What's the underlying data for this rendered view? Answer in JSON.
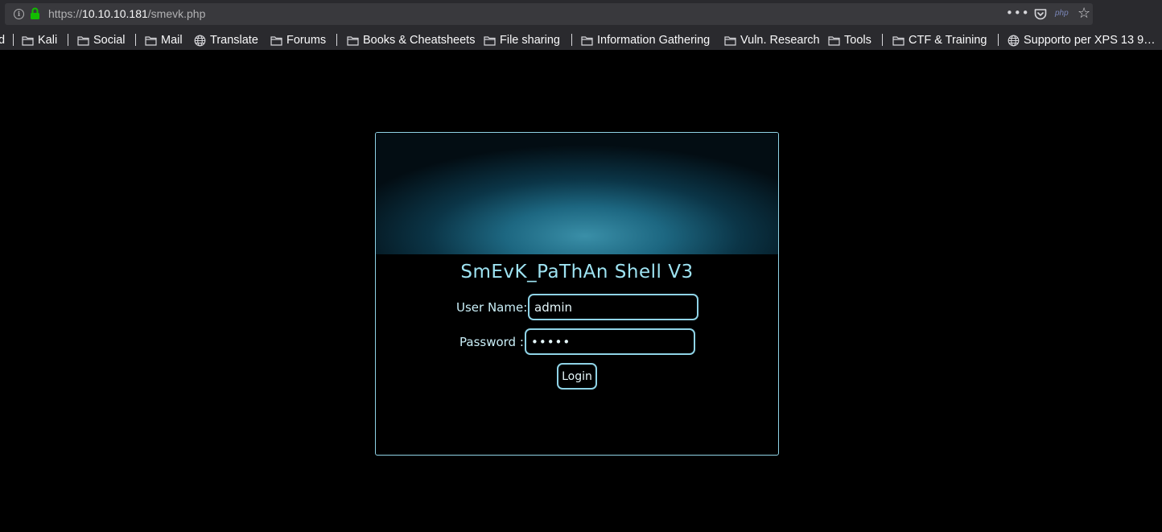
{
  "browser": {
    "url": {
      "scheme": "https://",
      "host": "10.10.10.181",
      "path": "/smevk.php"
    },
    "url_icons": [
      "info-icon",
      "lock-icon"
    ],
    "toolbar_icons": [
      "page-actions-icon",
      "pocket-icon",
      "php-icon",
      "star-icon"
    ],
    "php_label": "php",
    "page_actions_glyph": "•••",
    "star_glyph": "☆",
    "bookmarks": [
      {
        "label": "d",
        "icon": "none"
      },
      {
        "label": "Kali",
        "icon": "folder-icon"
      },
      {
        "label": "Social",
        "icon": "folder-icon"
      },
      {
        "label": "Mail",
        "icon": "folder-icon"
      },
      {
        "label": "Translate",
        "icon": "globe-icon"
      },
      {
        "label": "Forums",
        "icon": "folder-icon"
      },
      {
        "label": "Books & Cheatsheets",
        "icon": "folder-icon"
      },
      {
        "label": "File sharing",
        "icon": "folder-icon"
      },
      {
        "label": "Information Gathering",
        "icon": "folder-icon"
      },
      {
        "label": "Vuln. Research",
        "icon": "folder-icon"
      },
      {
        "label": "Tools",
        "icon": "folder-icon"
      },
      {
        "label": "CTF & Training",
        "icon": "folder-icon"
      },
      {
        "label": "Supporto per XPS 13 9…",
        "icon": "globe-icon"
      }
    ]
  },
  "login": {
    "title": "SmEvK_PaThAn Shell V3",
    "username_label": "User Name:",
    "username_value": "admin",
    "password_label": "Password :",
    "password_value": "•••••",
    "submit_label": "Login"
  },
  "colors": {
    "page_background": "#000000",
    "accent": "#8fd3e6",
    "title": "#9ee3f2",
    "chrome_background": "#2a2a2e",
    "lock_green": "#12bc00"
  }
}
